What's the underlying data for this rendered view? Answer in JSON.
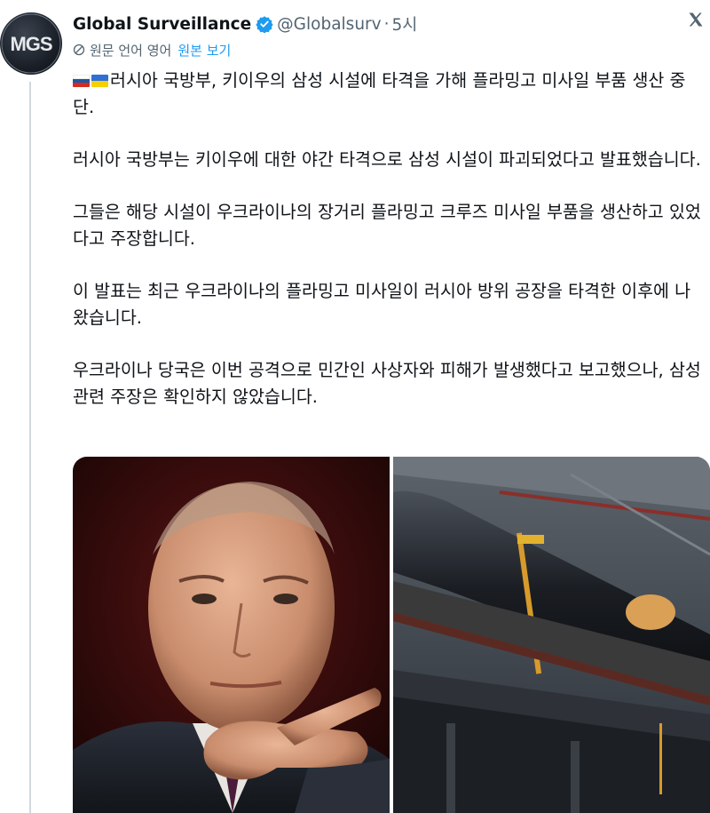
{
  "tweet": {
    "author": {
      "display_name": "Global Surveillance",
      "handle": "@Globalsurv",
      "avatar_text": "MGS",
      "verified": true
    },
    "separator": "·",
    "timestamp": "5시",
    "close_icon": "x-logo-icon",
    "translation": {
      "label": "원문 언어 영어",
      "show_original": "원본 보기"
    },
    "flags": [
      "russia-flag",
      "ukraine-flag"
    ],
    "paragraphs": [
      "러시아 국방부, 키이우의 삼성 시설에 타격을 가해 플라밍고 미사일 부품 생산 중단.",
      "러시아 국방부는 키이우에 대한 야간 타격으로 삼성 시설이 파괴되었다고 발표했습니다.",
      "그들은 해당 시설이 우크라이나의 장거리 플라밍고 크루즈 미사일 부품을 생산하고 있었다고 주장합니다.",
      "이 발표는 최근 우크라이나의 플라밍고 미사일이 러시아 방위 공장을 타격한 이후에 나왔습니다.",
      "우크라이나 당국은 이번 공격으로 민간인 사상자와 피해가 발생했다고 보고했으나, 삼성 관련 주장은 확인하지 않았습니다."
    ],
    "colors": {
      "text": "#0f1419",
      "secondary": "#536471",
      "link": "#1d9bf0",
      "verified": "#1d9bf0"
    }
  }
}
